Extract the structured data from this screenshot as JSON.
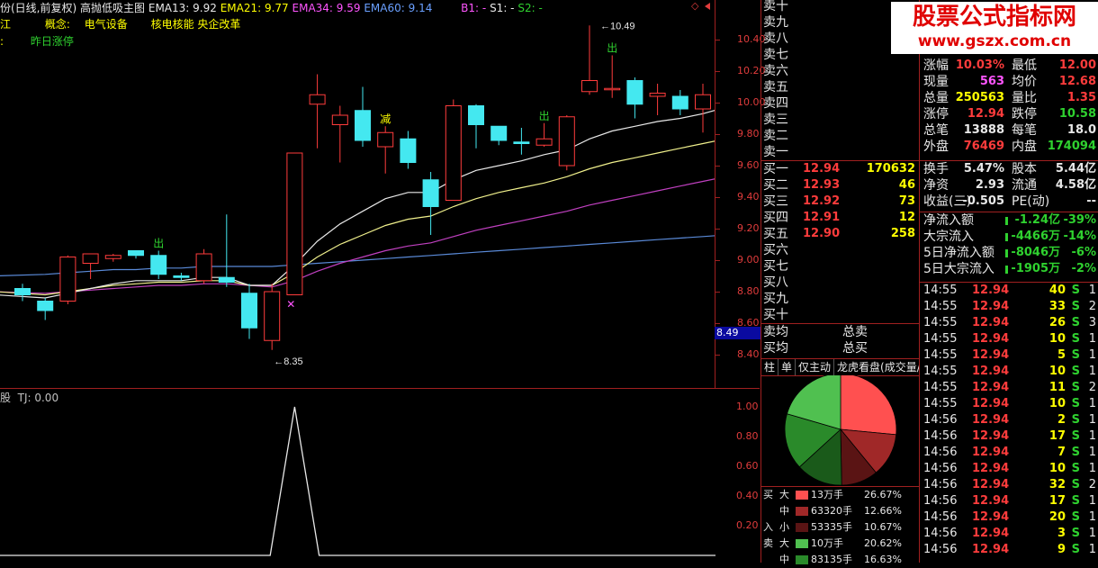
{
  "header": {
    "stock": "份(日线,前复权)",
    "indicator_name": "高抛低吸主图",
    "ema13": "EMA13: 9.92",
    "ema21": "EMA21: 9.77",
    "ema34": "EMA34: 9.59",
    "ema60": "EMA60: 9.14",
    "b1": "B1: -",
    "s1": "S1: -",
    "s2": "S2: -",
    "diamond": "◇",
    "line2_left": "江",
    "concept_label": "概念:",
    "concept_1": "电气设备",
    "concept_2": "核电核能 央企改革",
    "line3_left": ":",
    "line3_text": "昨日涨停"
  },
  "watermark": {
    "title": "股票公式指标网",
    "url": "www.gszx.com.cn"
  },
  "colors": {
    "up": "#ff3c3c",
    "down": "#44e8f0",
    "ema13": "#e8e8e8",
    "ema21": "#f0f08c",
    "ema34": "#c040c0",
    "ema60": "#5a8ad8"
  },
  "price_axis": {
    "labels": [
      "10.40",
      "10.20",
      "10.00",
      "9.80",
      "9.60",
      "9.40",
      "9.20",
      "9.00",
      "8.80",
      "8.60",
      "8.40"
    ],
    "current_tag": "8.49",
    "high_annot": "10.49",
    "low_annot": "8.35"
  },
  "chart_data": {
    "type": "candlestick",
    "ylim": [
      8.3,
      10.5
    ],
    "candles": [
      {
        "o": 8.82,
        "h": 8.85,
        "l": 8.74,
        "c": 8.78
      },
      {
        "o": 8.74,
        "h": 8.76,
        "l": 8.62,
        "c": 8.68
      },
      {
        "o": 8.74,
        "h": 9.03,
        "l": 8.72,
        "c": 9.02
      },
      {
        "o": 8.98,
        "h": 9.04,
        "l": 8.88,
        "c": 9.04
      },
      {
        "o": 9.01,
        "h": 9.04,
        "l": 8.99,
        "c": 9.03
      },
      {
        "o": 9.06,
        "h": 9.06,
        "l": 9.01,
        "c": 9.03
      },
      {
        "o": 9.03,
        "h": 9.06,
        "l": 8.88,
        "c": 8.91
      },
      {
        "o": 8.9,
        "h": 8.92,
        "l": 8.87,
        "c": 8.89
      },
      {
        "o": 8.87,
        "h": 9.07,
        "l": 8.85,
        "c": 9.04
      },
      {
        "o": 8.89,
        "h": 9.29,
        "l": 8.83,
        "c": 8.86
      },
      {
        "o": 8.79,
        "h": 8.85,
        "l": 8.5,
        "c": 8.57
      },
      {
        "o": 8.49,
        "h": 8.85,
        "l": 8.43,
        "c": 8.8
      },
      {
        "o": 8.78,
        "h": 9.68,
        "l": 8.78,
        "c": 9.68
      },
      {
        "o": 9.99,
        "h": 10.18,
        "l": 9.71,
        "c": 10.05
      },
      {
        "o": 9.86,
        "h": 9.98,
        "l": 9.62,
        "c": 9.92
      },
      {
        "o": 9.95,
        "h": 10.1,
        "l": 9.72,
        "c": 9.76
      },
      {
        "o": 9.72,
        "h": 9.85,
        "l": 9.55,
        "c": 9.81
      },
      {
        "o": 9.77,
        "h": 9.82,
        "l": 9.58,
        "c": 9.62
      },
      {
        "o": 9.51,
        "h": 9.56,
        "l": 9.16,
        "c": 9.34
      },
      {
        "o": 9.38,
        "h": 10.02,
        "l": 9.38,
        "c": 9.98
      },
      {
        "o": 9.98,
        "h": 9.99,
        "l": 9.71,
        "c": 9.86
      },
      {
        "o": 9.85,
        "h": 9.85,
        "l": 9.73,
        "c": 9.76
      },
      {
        "o": 9.75,
        "h": 9.84,
        "l": 9.67,
        "c": 9.74
      },
      {
        "o": 9.73,
        "h": 9.87,
        "l": 9.72,
        "c": 9.77
      },
      {
        "o": 9.6,
        "h": 9.92,
        "l": 9.57,
        "c": 9.91
      },
      {
        "o": 10.07,
        "h": 10.49,
        "l": 10.05,
        "c": 10.14
      },
      {
        "o": 10.09,
        "h": 10.3,
        "l": 10.03,
        "c": 10.09
      },
      {
        "o": 10.14,
        "h": 10.16,
        "l": 9.9,
        "c": 9.99
      },
      {
        "o": 10.04,
        "h": 10.12,
        "l": 9.92,
        "c": 10.06
      },
      {
        "o": 10.04,
        "h": 10.08,
        "l": 9.92,
        "c": 9.96
      },
      {
        "o": 9.96,
        "h": 10.12,
        "l": 9.81,
        "c": 10.05
      },
      {
        "o": 10.03,
        "h": 10.22,
        "l": 10.02,
        "c": 10.13
      }
    ],
    "ema13": [
      8.78,
      8.76,
      8.79,
      8.82,
      8.85,
      8.87,
      8.87,
      8.87,
      8.89,
      8.89,
      8.84,
      8.84,
      8.97,
      9.12,
      9.23,
      9.31,
      9.39,
      9.43,
      9.43,
      9.51,
      9.57,
      9.6,
      9.63,
      9.67,
      9.7,
      9.77,
      9.82,
      9.85,
      9.88,
      9.9,
      9.93,
      9.97
    ],
    "ema21": [
      8.8,
      8.78,
      8.8,
      8.82,
      8.84,
      8.85,
      8.86,
      8.86,
      8.87,
      8.87,
      8.84,
      8.84,
      8.92,
      9.02,
      9.1,
      9.16,
      9.22,
      9.26,
      9.28,
      9.34,
      9.39,
      9.43,
      9.46,
      9.49,
      9.53,
      9.58,
      9.62,
      9.65,
      9.68,
      9.71,
      9.74,
      9.77
    ],
    "ema34": [
      8.8,
      8.79,
      8.8,
      8.81,
      8.82,
      8.83,
      8.84,
      8.84,
      8.85,
      8.85,
      8.84,
      8.83,
      8.87,
      8.93,
      8.98,
      9.02,
      9.06,
      9.09,
      9.11,
      9.15,
      9.19,
      9.22,
      9.25,
      9.28,
      9.31,
      9.35,
      9.38,
      9.41,
      9.44,
      9.47,
      9.5,
      9.53
    ],
    "ema60": [
      8.9,
      8.91,
      8.92,
      8.93,
      8.94,
      8.94,
      8.95,
      8.95,
      8.96,
      8.96,
      8.96,
      8.96,
      8.97,
      8.98,
      8.99,
      9.0,
      9.01,
      9.02,
      9.03,
      9.04,
      9.05,
      9.06,
      9.07,
      9.08,
      9.09,
      9.1,
      9.11,
      9.12,
      9.13,
      9.14,
      9.15,
      9.16
    ],
    "signals": [
      {
        "index": 6,
        "text": "出"
      },
      {
        "index": 16,
        "text": "减"
      },
      {
        "index": 23,
        "text": "出"
      },
      {
        "index": 26,
        "text": "出"
      }
    ]
  },
  "sub_indicator": {
    "label": "股  TJ: 0.00",
    "axis": [
      "1.00",
      "0.80",
      "0.60",
      "0.40",
      "0.20"
    ]
  },
  "order_book": {
    "sell_labels": [
      "卖十",
      "卖九",
      "卖八",
      "卖七",
      "卖六",
      "卖五",
      "卖四",
      "卖三",
      "卖二",
      "卖一"
    ],
    "buy": [
      {
        "label": "买一",
        "price": "12.94",
        "vol": "170632"
      },
      {
        "label": "买二",
        "price": "12.93",
        "vol": "46"
      },
      {
        "label": "买三",
        "price": "12.92",
        "vol": "73"
      },
      {
        "label": "买四",
        "price": "12.91",
        "vol": "12"
      },
      {
        "label": "买五",
        "price": "12.90",
        "vol": "258"
      },
      {
        "label": "买六",
        "price": "",
        "vol": ""
      },
      {
        "label": "买七",
        "price": "",
        "vol": ""
      },
      {
        "label": "买八",
        "price": "",
        "vol": ""
      },
      {
        "label": "买九",
        "price": "",
        "vol": ""
      },
      {
        "label": "买十",
        "price": "",
        "vol": ""
      }
    ],
    "avg_sell": "卖均",
    "total_sell": "总卖",
    "avg_buy": "买均",
    "total_buy": "总买"
  },
  "quote": [
    {
      "a": "涨幅",
      "b": "10.03%",
      "bc": "red",
      "c": "最低",
      "d": "12.00",
      "dc": "red"
    },
    {
      "a": "现量",
      "b": "563",
      "bc": "mag",
      "c": "均价",
      "d": "12.68",
      "dc": "red"
    },
    {
      "a": "总量",
      "b": "250563",
      "bc": "yel",
      "c": "量比",
      "d": "1.35",
      "dc": "red"
    },
    {
      "a": "涨停",
      "b": "12.94",
      "bc": "red",
      "c": "跌停",
      "d": "10.58",
      "dc": "grn"
    },
    {
      "a": "总笔",
      "b": "13888",
      "bc": "wht",
      "c": "每笔",
      "d": "18.0",
      "dc": "wht"
    },
    {
      "a": "外盘",
      "b": "76469",
      "bc": "red",
      "c": "内盘",
      "d": "174094",
      "dc": "grn"
    }
  ],
  "fundamentals": [
    {
      "a": "换手",
      "b": "5.47%",
      "bc": "wht",
      "c": "股本",
      "d": "5.44亿",
      "dc": "wht"
    },
    {
      "a": "净资",
      "b": "2.93",
      "bc": "wht",
      "c": "流通",
      "d": "4.58亿",
      "dc": "wht"
    },
    {
      "a": "收益(三)",
      "b": "-0.505",
      "bc": "wht",
      "c": "PE(动)",
      "d": "--",
      "dc": "wht"
    }
  ],
  "flows": [
    {
      "label": "净流入额",
      "amt": "-1.24亿",
      "pct": "-39%"
    },
    {
      "label": "大宗流入",
      "amt": "-4466万",
      "pct": "-14%"
    },
    {
      "label": "5日净流入额",
      "amt": "-8046万",
      "pct": "-6%"
    },
    {
      "label": "5日大宗流入",
      "amt": "-1905万",
      "pct": "-2%"
    }
  ],
  "tabs": [
    "柱",
    "单",
    "仅主动",
    "龙虎看盘(成交量/"
  ],
  "pie": {
    "slices": [
      {
        "label": "买入大",
        "value": 26.67,
        "color": "#ff5050"
      },
      {
        "label": "买入中",
        "value": 12.66,
        "color": "#a02828"
      },
      {
        "label": "买入小",
        "value": 10.67,
        "color": "#5a1414"
      },
      {
        "label": "卖出小",
        "value": 13.6,
        "color": "#1a5a1a"
      },
      {
        "label": "卖出中",
        "value": 16.4,
        "color": "#2a8a2a"
      },
      {
        "label": "卖出大",
        "value": 20.62,
        "color": "#50c050"
      }
    ]
  },
  "legend": [
    {
      "side": "买",
      "size": "大",
      "amt": "13万手",
      "pct": "26.67%",
      "color": "#ff5050"
    },
    {
      "side": "",
      "size": "中",
      "amt": "63320手",
      "pct": "12.66%",
      "color": "#a02828"
    },
    {
      "side": "入",
      "size": "小",
      "amt": "53335手",
      "pct": "10.67%",
      "color": "#5a1414"
    },
    {
      "side": "卖",
      "size": "大",
      "amt": "10万手",
      "pct": "20.62%",
      "color": "#50c050"
    },
    {
      "side": "",
      "size": "中",
      "amt": "83135手",
      "pct": "16.63%",
      "color": "#2a8a2a"
    }
  ],
  "trades": [
    {
      "t": "14:55",
      "p": "12.94",
      "v": "40",
      "s": "S",
      "n": "1"
    },
    {
      "t": "14:55",
      "p": "12.94",
      "v": "33",
      "s": "S",
      "n": "2"
    },
    {
      "t": "14:55",
      "p": "12.94",
      "v": "26",
      "s": "S",
      "n": "3"
    },
    {
      "t": "14:55",
      "p": "12.94",
      "v": "10",
      "s": "S",
      "n": "1"
    },
    {
      "t": "14:55",
      "p": "12.94",
      "v": "5",
      "s": "S",
      "n": "1"
    },
    {
      "t": "14:55",
      "p": "12.94",
      "v": "10",
      "s": "S",
      "n": "1"
    },
    {
      "t": "14:55",
      "p": "12.94",
      "v": "11",
      "s": "S",
      "n": "2"
    },
    {
      "t": "14:55",
      "p": "12.94",
      "v": "10",
      "s": "S",
      "n": "1"
    },
    {
      "t": "14:56",
      "p": "12.94",
      "v": "2",
      "s": "S",
      "n": "1"
    },
    {
      "t": "14:56",
      "p": "12.94",
      "v": "17",
      "s": "S",
      "n": "1"
    },
    {
      "t": "14:56",
      "p": "12.94",
      "v": "7",
      "s": "S",
      "n": "1"
    },
    {
      "t": "14:56",
      "p": "12.94",
      "v": "10",
      "s": "S",
      "n": "1"
    },
    {
      "t": "14:56",
      "p": "12.94",
      "v": "32",
      "s": "S",
      "n": "2"
    },
    {
      "t": "14:56",
      "p": "12.94",
      "v": "17",
      "s": "S",
      "n": "1"
    },
    {
      "t": "14:56",
      "p": "12.94",
      "v": "20",
      "s": "S",
      "n": "1"
    },
    {
      "t": "14:56",
      "p": "12.94",
      "v": "3",
      "s": "S",
      "n": "1"
    },
    {
      "t": "14:56",
      "p": "12.94",
      "v": "9",
      "s": "S",
      "n": "1"
    }
  ]
}
